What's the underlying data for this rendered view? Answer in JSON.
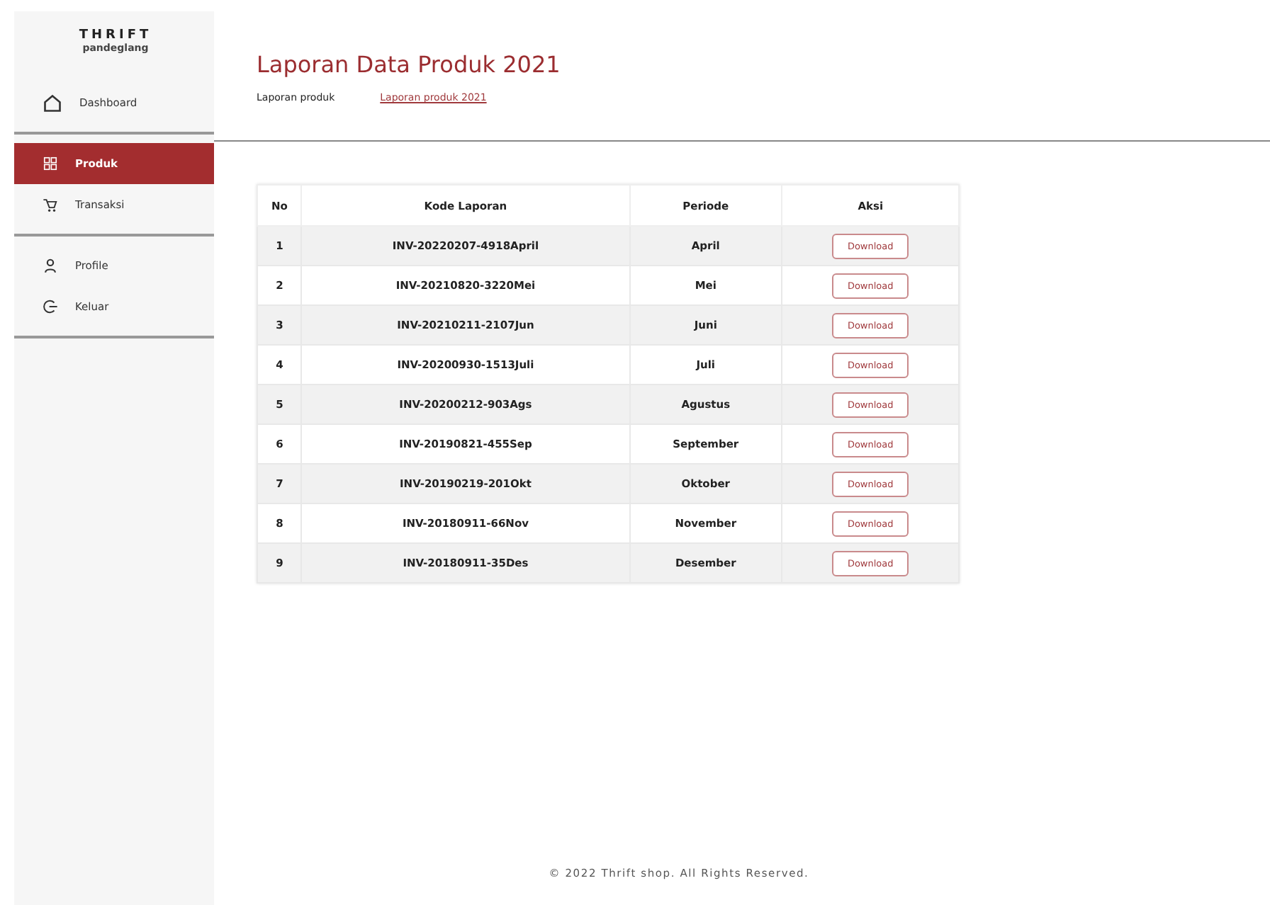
{
  "brand": {
    "title": "THRIFT",
    "subtitle": "pandeglang"
  },
  "sidebar": {
    "groups": [
      [
        {
          "label": "Dashboard",
          "kind": "home",
          "selected": false
        }
      ],
      [
        {
          "label": "Produk",
          "kind": "grid",
          "selected": true
        },
        {
          "label": "Transaksi",
          "kind": "cart",
          "selected": false
        }
      ],
      [
        {
          "label": "Profile",
          "kind": "person",
          "selected": false
        },
        {
          "label": "Keluar",
          "kind": "logout",
          "selected": false
        }
      ]
    ]
  },
  "page": {
    "title": "Laporan Data Produk 2021",
    "breadcrumb": [
      {
        "label": "Laporan produk",
        "kind": "plain"
      },
      {
        "label": "Laporan produk 2021",
        "kind": "link"
      }
    ]
  },
  "table": {
    "columns": [
      "No",
      "Kode Laporan",
      "Periode",
      "Aksi"
    ],
    "rows": [
      {
        "no": "1",
        "code": "INV-20220207-4918April",
        "period": "April",
        "action": "Download"
      },
      {
        "no": "2",
        "code": "INV-20210820-3220Mei",
        "period": "Mei",
        "action": "Download"
      },
      {
        "no": "3",
        "code": "INV-20210211-2107Jun",
        "period": "Juni",
        "action": "Download"
      },
      {
        "no": "4",
        "code": "INV-20200930-1513Juli",
        "period": "Juli",
        "action": "Download"
      },
      {
        "no": "5",
        "code": "INV-20200212-903Ags",
        "period": "Agustus",
        "action": "Download"
      },
      {
        "no": "6",
        "code": "INV-20190821-455Sep",
        "period": "September",
        "action": "Download"
      },
      {
        "no": "7",
        "code": "INV-20190219-201Okt",
        "period": "Oktober",
        "action": "Download"
      },
      {
        "no": "8",
        "code": "INV-20180911-66Nov",
        "period": "November",
        "action": "Download"
      },
      {
        "no": "9",
        "code": "INV-20180911-35Des",
        "period": "Desember",
        "action": "Download"
      }
    ]
  },
  "footer": "© 2022 Thrift shop. All Rights Reserved."
}
